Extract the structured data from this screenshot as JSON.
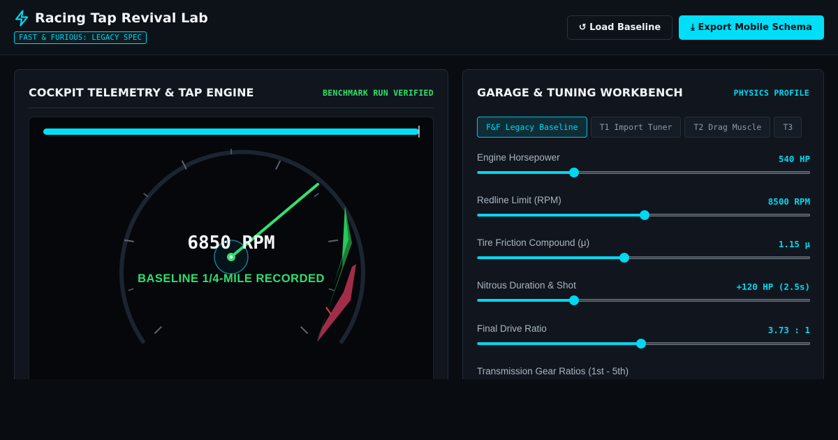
{
  "app": {
    "title": "Racing Tap Revival Lab",
    "spec_badge": "FAST & FURIOUS: LEGACY SPEC"
  },
  "header_actions": {
    "load_label": "↺ Load Baseline",
    "export_label": "⤓ Export Mobile Schema"
  },
  "telemetry_panel": {
    "title": "COCKPIT TELEMETRY & TAP ENGINE",
    "status": "BENCHMARK RUN VERIFIED",
    "rpm_readout": "6850 RPM",
    "status_message": "BASELINE 1/4-MILE RECORDED",
    "rpm_value": 6850,
    "rpm_max": 10000,
    "progress_fraction": 1.0
  },
  "workbench_panel": {
    "title": "GARAGE & TUNING WORKBENCH",
    "profile_tag": "PHYSICS PROFILE",
    "tabs": [
      {
        "label": "F&F Legacy Baseline",
        "active": true
      },
      {
        "label": "T1 Import Tuner",
        "active": false
      },
      {
        "label": "T2 Drag Muscle",
        "active": false
      },
      {
        "label": "T3",
        "active": false
      }
    ],
    "params": [
      {
        "label": "Engine Horsepower",
        "value": "540 HP",
        "level": 0.29
      },
      {
        "label": "Redline Limit (RPM)",
        "value": "8500 RPM",
        "level": 0.5
      },
      {
        "label": "Tire Friction Compound (μ)",
        "value": "1.15 μ",
        "level": 0.44
      },
      {
        "label": "Nitrous Duration & Shot",
        "value": "+120 HP (2.5s)",
        "level": 0.29
      },
      {
        "label": "Final Drive Ratio",
        "value": "3.73 : 1",
        "level": 0.49
      }
    ],
    "gear_label": "Transmission Gear Ratios (1st - 5th)"
  },
  "colors": {
    "accent": "#00d8f0",
    "success": "#2ee06a",
    "redline": "#c23a5a",
    "background": "#090c11"
  },
  "icons": {
    "brand": "lightning-bolt-icon",
    "load": "reload-icon",
    "export": "download-icon"
  }
}
